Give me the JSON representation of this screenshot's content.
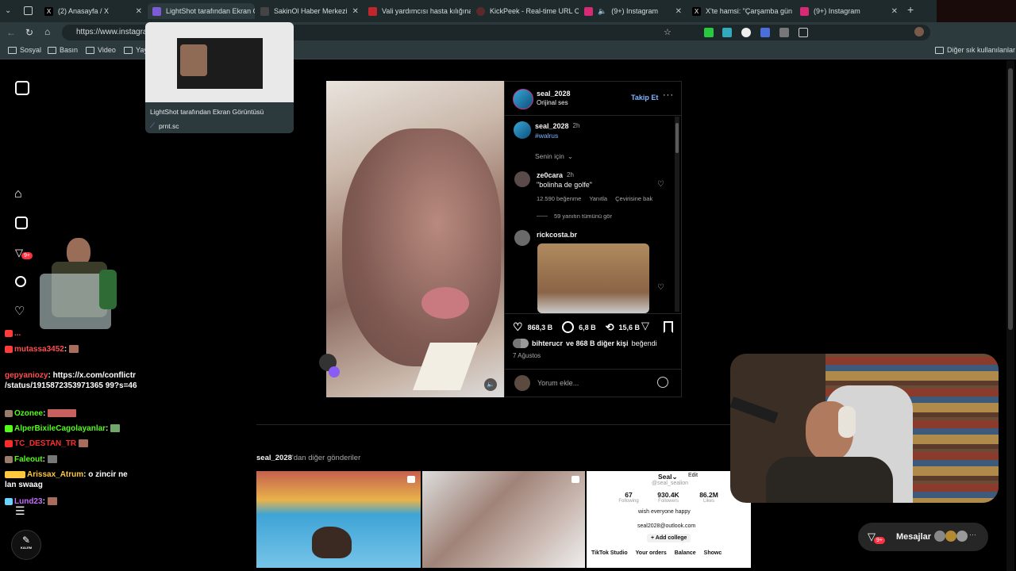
{
  "browser": {
    "tabs": [
      {
        "label": "(2) Anasayfa / X",
        "color": "#000000"
      },
      {
        "label": "LightShot tarafından Ekran Görüntüsü",
        "color": "#7b5cd6"
      },
      {
        "label": "SakinOl Haber Merkezi",
        "color": "#333333"
      },
      {
        "label": "Vali yardımcısı hasta kılığına",
        "color": "#c0272d"
      },
      {
        "label": "KickPeek - Real-time URL Cl",
        "color": "#4a1f1f"
      },
      {
        "label": "(9+) Instagram",
        "color": "#d62976"
      },
      {
        "label": "X'te hamsi: \"Çarşamba gün",
        "color": "#000000"
      },
      {
        "label": "(9+) Instagram",
        "color": "#d62976"
      }
    ],
    "url": "https://www.instagram.com",
    "bookmarks": [
      "Sosyal",
      "Basın",
      "Video",
      "Yay"
    ],
    "other_bookmarks": "Diğer sık kullanılanlar",
    "tooltip": {
      "title": "LightShot tarafından Ekran Görüntüsü",
      "domain": "prnt.sc"
    }
  },
  "post": {
    "author": "seal_2028",
    "audio": "Orijinal ses",
    "follow": "Takip Et",
    "caption_user": "seal_2028",
    "caption_time": "2h",
    "caption_tag": "#walrus",
    "filter": "Senin için",
    "comments": [
      {
        "user": "ze0cara",
        "time": "2h",
        "text": "\"bolinha de golfe\"",
        "likes": "12.590 beğenme",
        "reply": "Yanıtla",
        "translate": "Çevirisine bak",
        "view_replies": "59 yanıtın tümünü gör"
      },
      {
        "user": "rickcosta.br"
      }
    ],
    "stats": {
      "likes": "868,3 B",
      "comments": "6,8 B",
      "reposts": "15,6 B"
    },
    "liked_by_user": "bihterucr",
    "liked_by_rest": "ve 868 B diğer kişi",
    "liked_by_suffix": "beğendi",
    "date": "7 Ağustos",
    "comment_placeholder": "Yorum ekle..."
  },
  "more_posts": {
    "user": "seal_2028",
    "suffix": "'dan diğer gönderiler",
    "profile_preview": {
      "name": "Seal",
      "edit": "Edit",
      "handle": "@seal_sealion",
      "stats": [
        {
          "value": "67",
          "label": "Following"
        },
        {
          "value": "930.4K",
          "label": "Followers"
        },
        {
          "value": "86.2M",
          "label": "Likes"
        }
      ],
      "bio": "wish everyone happy",
      "email": "seal2028@outlook.com",
      "add_college": "+ Add college",
      "links": [
        "TikTok Studio",
        "Your orders",
        "Balance",
        "Showc"
      ]
    }
  },
  "chat": [
    {
      "user": "gepyaniozy",
      "text": "https://x.com/conflictr /status/1915872353971365 99?s=46",
      "color": "#ff4f4f"
    },
    {
      "user": "mutassa3452",
      "text": "",
      "color": "#ff4f4f"
    },
    {
      "user": "Ozonee",
      "text": "",
      "color": "#53fc18"
    },
    {
      "user": "AlperBixileCagolayanlar",
      "text": "",
      "color": "#53fc18"
    },
    {
      "user": "TC_DESTAN_TR",
      "text": "",
      "color": "#ff2b2b"
    },
    {
      "user": "Faleout",
      "text": "",
      "color": "#53fc18"
    },
    {
      "user": "Arissax_Atrum",
      "text": "o zincir ne lan swaag",
      "color": "#ffc83d"
    },
    {
      "user": "Lund23",
      "text": "",
      "color": "#c86bff"
    }
  ],
  "chat_first_line": "gepyaniozy: https://x.com/conflictr",
  "chat_first_line2": "/status/1915872353971365 99?",
  "chat_first_line3": "s=46",
  "nav_badge": "9+",
  "messages": {
    "label": "Mesajlar",
    "badge": "9+"
  },
  "logo_text": "KALEM"
}
